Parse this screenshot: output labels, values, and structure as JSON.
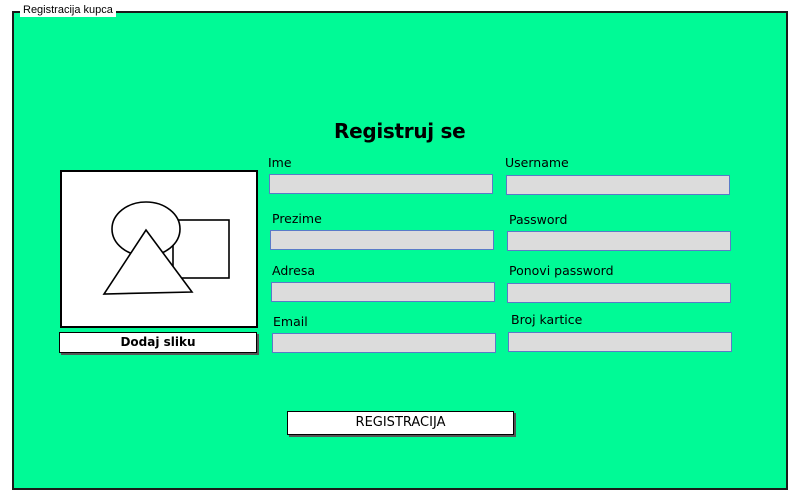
{
  "window": {
    "title": "Registracija kupca"
  },
  "form": {
    "heading": "Registruj se",
    "fields": {
      "ime": {
        "label": "Ime",
        "value": ""
      },
      "username": {
        "label": "Username",
        "value": ""
      },
      "prezime": {
        "label": "Prezime",
        "value": ""
      },
      "password": {
        "label": "Password",
        "value": ""
      },
      "adresa": {
        "label": "Adresa",
        "value": ""
      },
      "ponovi_password": {
        "label": "Ponovi password",
        "value": ""
      },
      "email": {
        "label": "Email",
        "value": ""
      },
      "broj_kartice": {
        "label": "Broj kartice",
        "value": ""
      }
    },
    "image": {
      "icon": "image-placeholder-icon",
      "add_button_label": "Dodaj sliku"
    },
    "submit_label": "REGISTRACIJA"
  },
  "colors": {
    "background": "#00fa96",
    "input_fill": "#dcdcdc",
    "input_border": "#5a7ac8"
  }
}
